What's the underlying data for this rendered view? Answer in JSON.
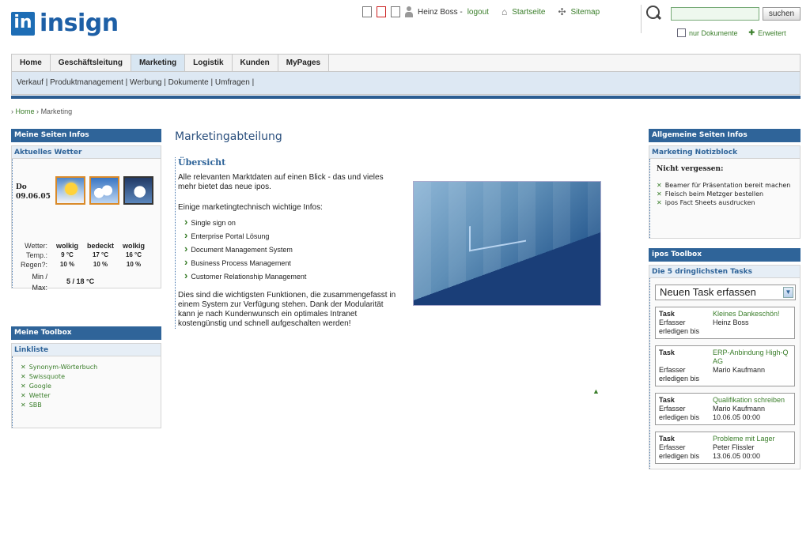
{
  "header": {
    "logo_mark": "in",
    "logo_text": "insign",
    "user_name": "Heinz Boss -",
    "logout_label": "logout",
    "startseite_label": "Startseite",
    "sitemap_label": "Sitemap",
    "search_placeholder": "",
    "search_button": "suchen",
    "only_docs_label": "nur Dokumente",
    "advanced_label": "Erweitert"
  },
  "nav": {
    "tabs": [
      {
        "label": "Home"
      },
      {
        "label": "Geschäftsleitung"
      },
      {
        "label": "Marketing"
      },
      {
        "label": "Logistik"
      },
      {
        "label": "Kunden"
      },
      {
        "label": "MyPages"
      }
    ],
    "subnav": "Verkauf | Produktmanagement | Werbung | Dokumente | Umfragen |"
  },
  "breadcrumb": {
    "home": "Home",
    "current": "Marketing"
  },
  "left": {
    "my_infos_title": "Meine Seiten Infos",
    "weather": {
      "title": "Aktuelles Wetter",
      "day": "Do",
      "date": "09.06.05",
      "labels": {
        "weather": "Wetter:",
        "temp": "Temp.:",
        "rain": "Regen?:",
        "minmax_1": "Min /",
        "minmax_2": "Max:"
      },
      "conditions": [
        "wolkig",
        "bedeckt",
        "wolkig"
      ],
      "temps": [
        "9 °C",
        "17 °C",
        "16 °C"
      ],
      "rain": [
        "10 %",
        "10 %",
        "10 %"
      ],
      "minmax": "5 / 18 °C"
    },
    "toolbox_title": "Meine Toolbox",
    "linklist_title": "Linkliste",
    "links": [
      "Synonym-Wörterbuch",
      "Swissquote",
      "Google",
      "Wetter",
      "SBB"
    ]
  },
  "center": {
    "page_title": "Marketingabteilung",
    "section_title": "Übersicht",
    "intro": "Alle relevanten Marktdaten auf einen Blick - das und vieles mehr bietet das neue ipos.",
    "info_intro": "Einige marketingtechnisch wichtige Infos:",
    "features": [
      "Single sign on",
      "Enterprise Portal Lösung",
      "Document Management System",
      "Business Process Management",
      "Customer Relationship Management"
    ],
    "closing": "Dies sind die wichtigsten Funktionen, die zusammengefasst in einem System zur Verfügung stehen. Dank der Modularität kann je nach Kundenwunsch ein optimales Intranet kostengünstig und schnell aufgeschalten werden!"
  },
  "right": {
    "general_title": "Allgemeine Seiten Infos",
    "notiz_title": "Marketing Notizblock",
    "notiz_head": "Nicht vergessen:",
    "notiz_items": [
      "Beamer für Präsentation bereit machen",
      "Fleisch beim Metzger bestellen",
      "ipos Fact Sheets ausdrucken"
    ],
    "toolbox_title": "ipos Toolbox",
    "tasks_title": "Die 5 dringlichsten Tasks",
    "new_task": "Neuen Task erfassen",
    "task_label": "Task",
    "erfasser_label": "Erfasser",
    "erledigen_label": "erledigen bis",
    "tasks": [
      {
        "name": "Kleines Dankeschön!",
        "erfasser": "Heinz Boss",
        "due": ""
      },
      {
        "name": "ERP-Anbindung High-Q AG",
        "erfasser": "Mario Kaufmann",
        "due": ""
      },
      {
        "name": "Qualifikation schreiben",
        "erfasser": "Mario Kaufmann",
        "due": "10.06.05 00:00"
      },
      {
        "name": "Probleme mit Lager",
        "erfasser": "Peter Flissler",
        "due": "13.06.05 00:00"
      }
    ]
  }
}
